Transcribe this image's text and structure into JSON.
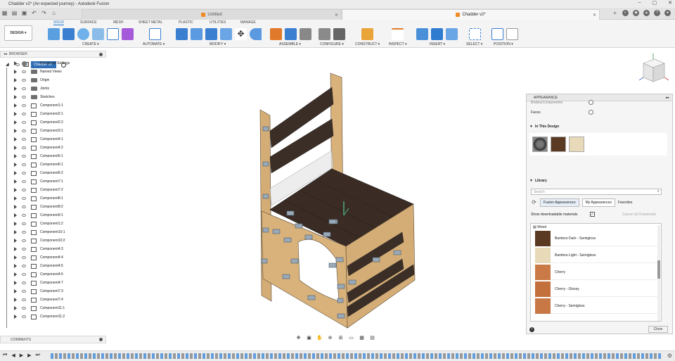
{
  "window": {
    "title": "Chadder v2* (An expected journey) - Autodesk Fusion"
  },
  "tabs": [
    {
      "label": "Untitled",
      "active": false
    },
    {
      "label": "Chadder v2*",
      "active": true
    }
  ],
  "toolbar": {
    "design_label": "DESIGN",
    "tabs": [
      "SOLID",
      "SURFACE",
      "MESH",
      "SHEET METAL",
      "PLASTIC",
      "UTILITIES",
      "MANAGE"
    ],
    "groups": [
      "CREATE",
      "AUTOMATE",
      "MODIFY",
      "ASSEMBLE",
      "CONFIGURE",
      "CONSTRUCT",
      "INSPECT",
      "INSERT",
      "SELECT",
      "POSITION"
    ]
  },
  "browser": {
    "header": "BROWSER",
    "root": "Chadder v2",
    "items": [
      {
        "label": "Document Settings",
        "type": "gear"
      },
      {
        "label": "Named Views",
        "type": "folder"
      },
      {
        "label": "Origin",
        "type": "folder"
      },
      {
        "label": "Joints",
        "type": "folder"
      },
      {
        "label": "Sketches",
        "type": "folder"
      },
      {
        "label": "Component1:1",
        "type": "component"
      },
      {
        "label": "Component2:1",
        "type": "component"
      },
      {
        "label": "Component2:2",
        "type": "component"
      },
      {
        "label": "Component3:1",
        "type": "component"
      },
      {
        "label": "Component4:1",
        "type": "component"
      },
      {
        "label": "Component4:2",
        "type": "component"
      },
      {
        "label": "Component5:1",
        "type": "component"
      },
      {
        "label": "Component6:1",
        "type": "component"
      },
      {
        "label": "Component6:2",
        "type": "component"
      },
      {
        "label": "Component7:1",
        "type": "component"
      },
      {
        "label": "Component7:2",
        "type": "component"
      },
      {
        "label": "Component8:1",
        "type": "component"
      },
      {
        "label": "Component8:2",
        "type": "component"
      },
      {
        "label": "Component9:1",
        "type": "component"
      },
      {
        "label": "Component1:2",
        "type": "component"
      },
      {
        "label": "Component10:1",
        "type": "component"
      },
      {
        "label": "Component10:2",
        "type": "component"
      },
      {
        "label": "Component4:3",
        "type": "component"
      },
      {
        "label": "Component4:4",
        "type": "component"
      },
      {
        "label": "Component4:5",
        "type": "component"
      },
      {
        "label": "Component4:6",
        "type": "component"
      },
      {
        "label": "Component4:7",
        "type": "component"
      },
      {
        "label": "Component7:3",
        "type": "component"
      },
      {
        "label": "Component7:4",
        "type": "component"
      },
      {
        "label": "Component11:1",
        "type": "component"
      },
      {
        "label": "Component11:2",
        "type": "component"
      }
    ]
  },
  "comments": {
    "label": "COMMENTS"
  },
  "appearance": {
    "title": "APPEARANCE",
    "apply_to_1": "Bodies/Components",
    "apply_to_2": "Faces",
    "in_this_design": "In This Design",
    "library": "Library",
    "search_placeholder": "Search",
    "lib_tabs": [
      "Fusion Appearances",
      "My Appearances",
      "Favorites"
    ],
    "show_downloadable": "Show downloadable materials",
    "cancel_all": "Cancel all Downloads",
    "folder": "Wood",
    "materials": [
      {
        "label": "Bamboo Dark - Semigloss",
        "color": "#5a3a22"
      },
      {
        "label": "Bamboo Light - Semigloss",
        "color": "#e8d9b8"
      },
      {
        "label": "Cherry",
        "color": "#c97a46"
      },
      {
        "label": "Cherry - Glossy",
        "color": "#c3703c"
      },
      {
        "label": "Cherry - Semigloss",
        "color": "#c77844"
      }
    ],
    "close_label": "Close"
  },
  "colors": {
    "accent": "#1a73c7",
    "wood_light": "#d9b27a",
    "wood_dark": "#3a2a22",
    "selection": "#2f6db5"
  }
}
